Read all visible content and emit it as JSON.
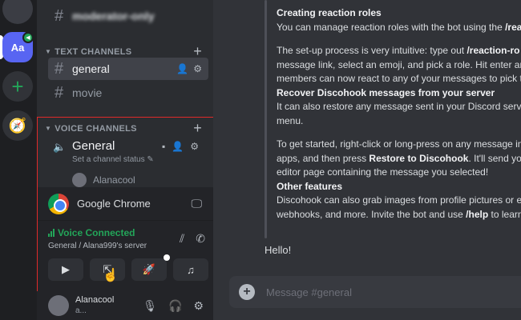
{
  "server_rail": {
    "active_server_abbr": "Aa",
    "add_server": "+",
    "explore": "🧭"
  },
  "sidebar": {
    "top_channel": "moderator-only",
    "text_category": "TEXT CHANNELS",
    "text_channels": [
      {
        "name": "general"
      },
      {
        "name": "movie"
      }
    ],
    "voice_category": "VOICE CHANNELS",
    "voice_channel": {
      "name": "General",
      "status_placeholder": "Set a channel status"
    },
    "voice_member": "Alanacool"
  },
  "voice_panel": {
    "stream_app": "Google Chrome",
    "status": "Voice Connected",
    "location": "General / Alana999's server"
  },
  "user_panel": {
    "name": "Alanacool",
    "sub": "a..."
  },
  "chat": {
    "lines": [
      {
        "kind": "heading",
        "text": "Creating reaction roles"
      },
      {
        "kind": "text",
        "pre": "You can manage reaction roles with the bot using the ",
        "bold": "/rea",
        "post": ""
      },
      {
        "kind": "gap"
      },
      {
        "kind": "text",
        "pre": "The set-up process is very intuitive: type out ",
        "bold": "/reaction-ro",
        "post": ""
      },
      {
        "kind": "text",
        "pre": "message link, select an emoji, and pick a role. Hit enter and",
        "bold": "",
        "post": ""
      },
      {
        "kind": "text",
        "pre": "members can now react to any of your messages to pick th",
        "bold": "",
        "post": ""
      },
      {
        "kind": "heading",
        "text": "Recover Discohook messages from your server"
      },
      {
        "kind": "text",
        "pre": "It can also restore any message sent in your Discord server",
        "bold": "",
        "post": ""
      },
      {
        "kind": "text",
        "pre": "menu.",
        "bold": "",
        "post": ""
      },
      {
        "kind": "gap"
      },
      {
        "kind": "text",
        "pre": "To get started, right-click or long-press on any message in",
        "bold": "",
        "post": ""
      },
      {
        "kind": "text",
        "pre": "apps, and then press ",
        "bold": "Restore to Discohook",
        "post": ". It'll send you"
      },
      {
        "kind": "text",
        "pre": "editor page containing the message you selected!",
        "bold": "",
        "post": ""
      },
      {
        "kind": "heading",
        "text": "Other features"
      },
      {
        "kind": "text",
        "pre": "Discohook can also grab images from profile pictures or er",
        "bold": "",
        "post": ""
      },
      {
        "kind": "text",
        "pre": "webhooks, and more. Invite the bot and use ",
        "bold": "/help",
        "post": " to learn"
      }
    ],
    "hello": "Hello!",
    "composer_placeholder": "Message #general"
  }
}
